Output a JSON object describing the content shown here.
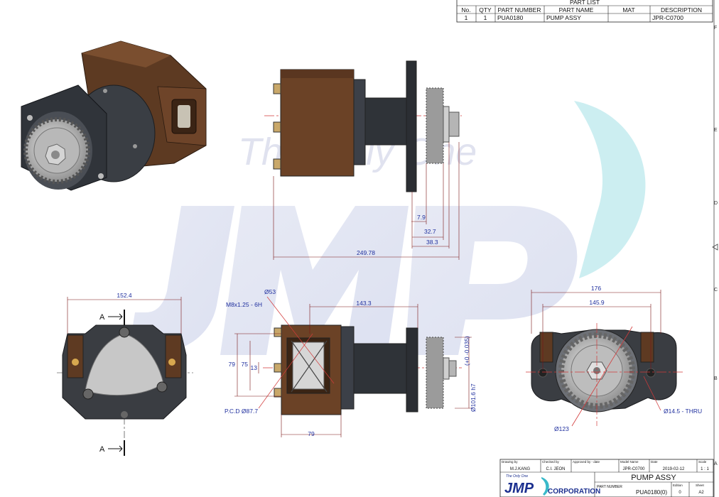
{
  "watermark": {
    "text": "The Only One"
  },
  "part_list": {
    "title": "PART LIST",
    "headers": [
      "No.",
      "QTY",
      "PART NUMBER",
      "PART NAME",
      "MAT",
      "DESCRIPTION"
    ],
    "rows": [
      {
        "no": "1",
        "qty": "1",
        "part_number": "PUA0180",
        "part_name": "PUMP ASSY",
        "mat": "",
        "description": "JPR-C0700"
      }
    ]
  },
  "zones": [
    "F",
    "E",
    "D",
    "C",
    "B",
    "A"
  ],
  "section": {
    "label": "A"
  },
  "dimensions": {
    "overall_length": "249.78",
    "d7_9": "7.9",
    "d32_7": "32.7",
    "d38_3": "38.3",
    "front_width": "152.4",
    "d143_3": "143.3",
    "d79": "79",
    "d75": "75",
    "d13": "13",
    "dia53": "Ø53",
    "thread": "M8x1.25 - 6H",
    "pcd": "P.C.D Ø87.7",
    "shaft_fit": "Ø101.6 h7",
    "shaft_tolerance": "(+0 -0.035)",
    "rear_width": "176",
    "hole_spacing": "145.9",
    "thru_hole": "Ø14.5 - THRU",
    "dia123": "Ø123"
  },
  "title_block": {
    "drawing_by_label": "Drawing by",
    "drawing_by": "M.J.KANG",
    "checked_by_label": "Checked by",
    "checked_by": "C.I. JEON",
    "approved_label": "Approved by - date",
    "model_name_label": "Model Name",
    "model_name": "JPR-C0700",
    "date_label": "Date",
    "date": "2019-02-12",
    "scale_label": "Scale",
    "scale": "1 : 1",
    "title": "PUMP ASSY",
    "part_number_label": "PART NUMBER",
    "part_number": "PUA0180(0)",
    "edition_label": "Edition",
    "edition": "0",
    "sheet_label": "Sheet",
    "sheet": "A2",
    "logo_tagline": "The Only One",
    "logo_name": "JMP",
    "logo_suffix": "CORPORATION"
  }
}
